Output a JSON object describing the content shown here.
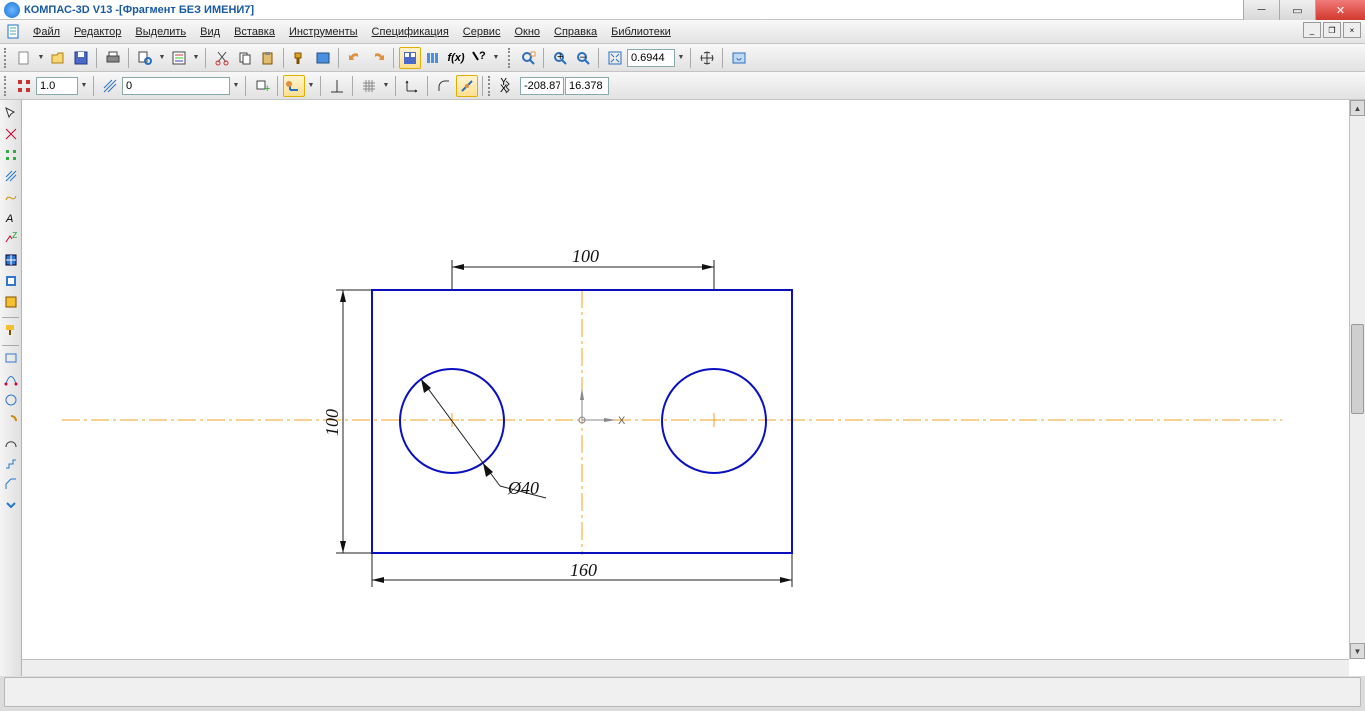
{
  "title": {
    "app": "КОМПАС-3D V13 - ",
    "doc": "[Фрагмент БЕЗ ИМЕНИ7]"
  },
  "menu": {
    "file": "Файл",
    "edit": "Редактор",
    "select": "Выделить",
    "view": "Вид",
    "insert": "Вставка",
    "tools": "Инструменты",
    "spec": "Спецификация",
    "service": "Сервис",
    "window": "Окно",
    "help": "Справка",
    "libs": "Библиотеки"
  },
  "toolbar": {
    "zoom_value": "0.6944",
    "scale_value": "1.0",
    "layer_value": "0",
    "coord_x": "-208.87",
    "coord_y": "16.378"
  },
  "side_icons": [
    "select-tool",
    "geometry-tool",
    "dimensions-tool",
    "hatch-tool",
    "spline-tool",
    "text-tool",
    "table-tool",
    "roughness-tool",
    "weld-tool",
    "dim-auto-tool",
    "doc-tool",
    "edit-tool",
    "param-tool",
    "measure-tool",
    "arc-tool",
    "arc-3p-tool",
    "tangent-tool",
    "angle-tool",
    "chamfer-tool",
    "fillet-tool",
    "more-tool"
  ],
  "drawing": {
    "dim_100_top": "100",
    "dim_100_left": "100",
    "dim_160_bottom": "160",
    "dim_diam": "Ø40",
    "axis_x_label": "X"
  }
}
